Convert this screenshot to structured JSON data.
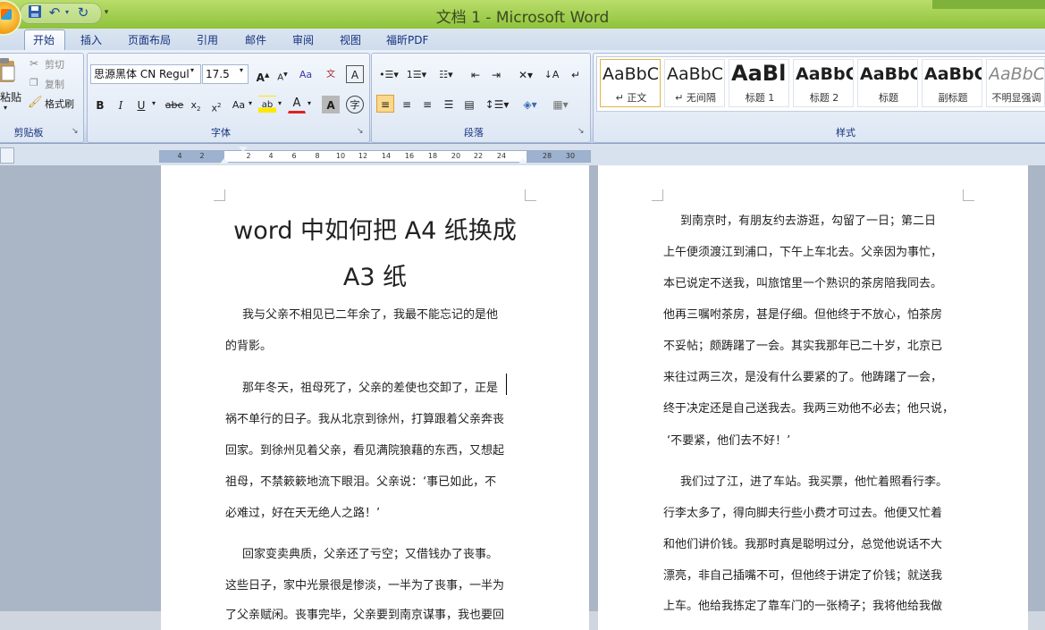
{
  "window": {
    "title": "文档 1 - Microsoft Word"
  },
  "tabs": [
    "开始",
    "插入",
    "页面布局",
    "引用",
    "邮件",
    "审阅",
    "视图",
    "福昕PDF"
  ],
  "clipboard": {
    "paste": "粘贴",
    "cut": "剪切",
    "copy": "复制",
    "format_painter": "格式刷",
    "label": "剪贴板"
  },
  "font": {
    "name": "思源黑体 CN Regul",
    "size": "17.5",
    "label": "字体"
  },
  "paragraph": {
    "label": "段落"
  },
  "styles": {
    "label": "样式",
    "items": [
      {
        "sample": "AaBbC",
        "name": "↵ 正文"
      },
      {
        "sample": "AaBbC",
        "name": "↵ 无间隔"
      },
      {
        "sample": "AaBl",
        "name": "标题 1"
      },
      {
        "sample": "AaBbC",
        "name": "标题 2"
      },
      {
        "sample": "AaBbC",
        "name": "标题"
      },
      {
        "sample": "AaBbC",
        "name": "副标题"
      },
      {
        "sample": "AaBbC",
        "name": "不明显强调"
      }
    ]
  },
  "ruler": {
    "numbers": [
      "4",
      "2",
      "2",
      "4",
      "6",
      "8",
      "10",
      "12",
      "14",
      "16",
      "18",
      "20",
      "22",
      "24",
      "28",
      "30"
    ]
  },
  "document": {
    "left_page": {
      "title_line1": "word 中如何把 A4 纸换成",
      "title_line2": "A3 纸",
      "lines": [
        "我与父亲不相见已二年余了，我最不能忘记的是他",
        "的背影。",
        "那年冬天，祖母死了，父亲的差使也交卸了，正是",
        "祸不单行的日子。我从北京到徐州，打算跟着父亲奔丧",
        "回家。到徐州见着父亲，看见满院狼藉的东西，又想起",
        "祖母，不禁簌簌地流下眼泪。父亲说：‘事已如此，不",
        "必难过，好在天无绝人之路！’",
        "回家变卖典质，父亲还了亏空；又借钱办了丧事。",
        "这些日子，家中光景很是惨淡，一半为了丧事，一半为",
        "了父亲赋闲。丧事完毕，父亲要到南京谋事，我也要回"
      ]
    },
    "right_page": {
      "lines": [
        "到南京时，有朋友约去游逛，勾留了一日；第二日",
        "上午便须渡江到浦口，下午上车北去。父亲因为事忙，",
        "本已说定不送我，叫旅馆里一个熟识的茶房陪我同去。",
        "他再三嘱咐茶房，甚是仔细。但他终于不放心，怕茶房",
        "不妥帖；颇踌躇了一会。其实我那年已二十岁，北京已",
        "来往过两三次，是没有什么要紧的了。他踌躇了一会，",
        "终于决定还是自己送我去。我两三劝他不必去；他只说，",
        "‘不要紧，他们去不好！’",
        "我们过了江，进了车站。我买票，他忙着照看行李。",
        "行李太多了，得向脚夫行些小费才可过去。他便又忙着",
        "和他们讲价钱。我那时真是聪明过分，总觉他说话不大",
        "漂亮，非自己插嘴不可，但他终于讲定了价钱；就送我",
        "上车。他给我拣定了靠车门的一张椅子；我将他给我做"
      ]
    }
  }
}
